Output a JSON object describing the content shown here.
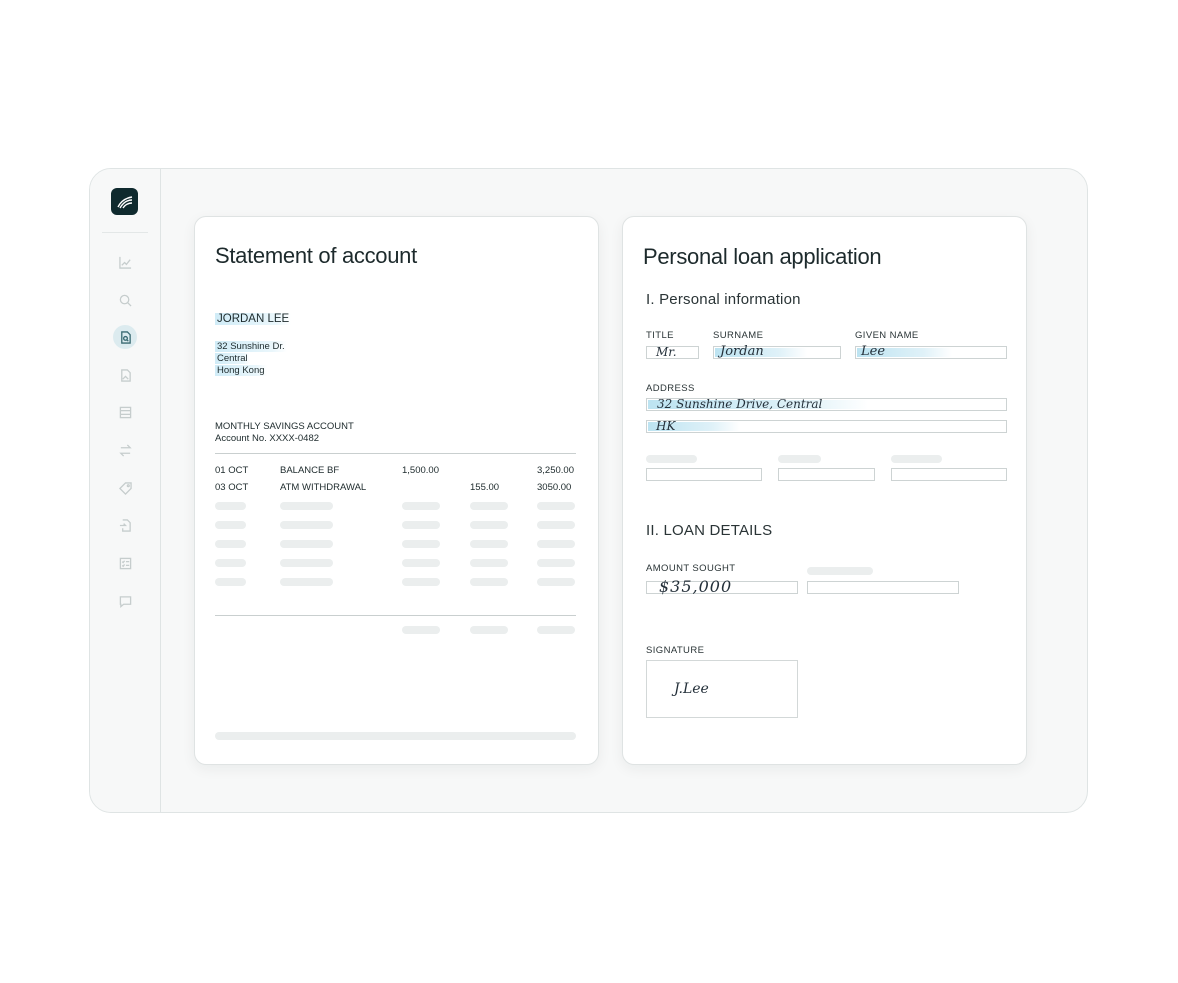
{
  "statement": {
    "title": "Statement of account",
    "name": "JORDAN LEE",
    "address": [
      "32 Sunshine Dr.",
      "Central",
      "Hong Kong"
    ],
    "account_type": "MONTHLY SAVINGS ACCOUNT",
    "account_no": "Account No. XXXX-0482",
    "rows": [
      {
        "date": "01 OCT",
        "desc": "BALANCE BF",
        "col1": "1,500.00",
        "col2": "",
        "balance": "3,250.00"
      },
      {
        "date": "03 OCT",
        "desc": "ATM WITHDRAWAL",
        "col1": "",
        "col2": "155.00",
        "balance": "3050.00"
      }
    ]
  },
  "application": {
    "title": "Personal loan application",
    "section1": "I. Personal information",
    "labels": {
      "title": "TITLE",
      "surname": "SURNAME",
      "given_name": "GIVEN NAME",
      "address": "ADDRESS",
      "amount": "AMOUNT SOUGHT",
      "signature": "SIGNATURE"
    },
    "values": {
      "title": "Mr.",
      "surname": "Jordan",
      "given_name": "Lee",
      "address_line1": "32 Sunshine Drive, Central",
      "address_line2": "HK",
      "amount": "$35,000",
      "signature": "J.Lee"
    },
    "section2": "II. LOAN DETAILS"
  },
  "sidebar": {
    "icons": [
      "chart-icon",
      "search-icon",
      "document-search-icon",
      "image-file-icon",
      "layout-icon",
      "transfer-icon",
      "tag-icon",
      "file-import-icon",
      "checklist-icon",
      "chat-icon"
    ],
    "active_index": 2
  },
  "colors": {
    "accent": "#0f2a2e",
    "highlight": "#aadcf0"
  }
}
